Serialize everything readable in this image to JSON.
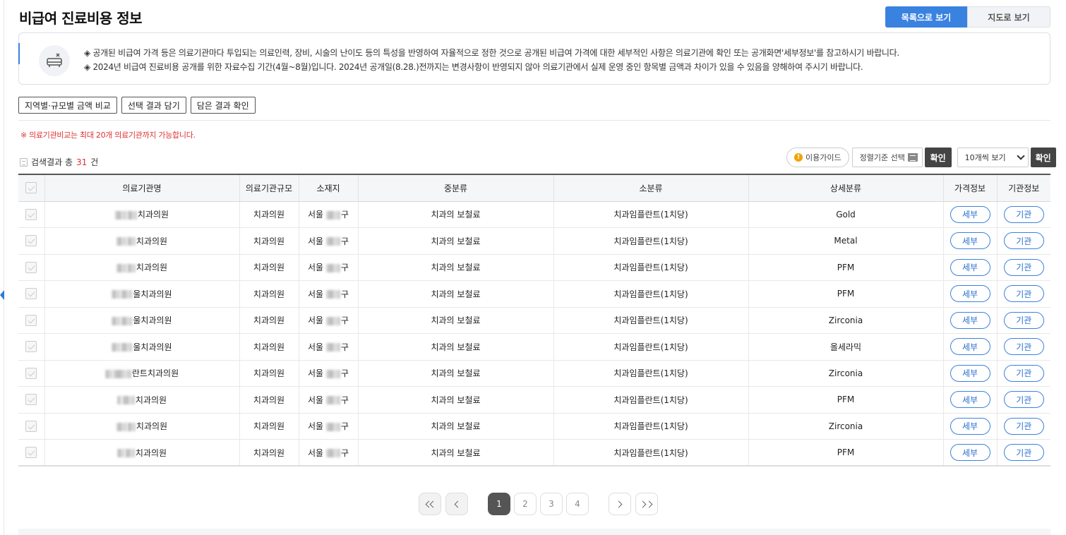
{
  "title": "비급여 진료비용 정보",
  "view_toggle": {
    "list": "목록으로 보기",
    "map": "지도로 보기"
  },
  "notice": {
    "icon": "hospital-bed-icon",
    "lines": [
      "◈ 공개된 비급여 가격 등은 의료기관마다 투입되는 의료인력, 장비, 시술의 난이도 등의 특성을 반영하여 자율적으로 정한 것으로 공개된 비급여 가격에 대한 세부적인 사항은 의료기관에 확인 또는 공개화면'세부정보'를 참고하시기 바랍니다.",
      "◈ 2024년 비급여 진료비용 공개를 위한 자료수집 기간(4월~8월)입니다. 2024년 공개일(8.28.)전까지는 변경사항이 반영되지 않아 의료기관에서 실제 운영 중인 항목별 금액과 차이가 있을 수 있음을 양해하여 주시기 바랍니다."
    ]
  },
  "actions": {
    "compare": "지역별·규모별 금액 비교",
    "add_selected": "선택 결과 담기",
    "view_saved": "담은 결과 확인"
  },
  "warning": "※ 의료기관비교는 최대 20개 의료기관까지 가능합니다.",
  "results": {
    "prefix": "검색결과 총",
    "count": "31",
    "suffix": "건"
  },
  "controls": {
    "guide": "이용가이드",
    "sort_placeholder": "정렬기준 선택",
    "confirm": "확인",
    "per_page": "10개씩 보기"
  },
  "table": {
    "headers": [
      "의료기관명",
      "의료기관규모",
      "소재지",
      "중분류",
      "소분류",
      "상세분류",
      "가격정보",
      "기관정보"
    ],
    "detail_label": "세부",
    "institution_label": "기관",
    "rows": [
      {
        "name": "치과의원",
        "size": "치과의원",
        "loc_prefix": "서울",
        "loc_suffix": "구",
        "mid": "치과의 보철료",
        "sub": "치과임플란트(1치당)",
        "detail": "Gold"
      },
      {
        "name": "치과의원",
        "size": "치과의원",
        "loc_prefix": "서울",
        "loc_suffix": "구",
        "mid": "치과의 보철료",
        "sub": "치과임플란트(1치당)",
        "detail": "Metal"
      },
      {
        "name": "치과의원",
        "size": "치과의원",
        "loc_prefix": "서울",
        "loc_suffix": "구",
        "mid": "치과의 보철료",
        "sub": "치과임플란트(1치당)",
        "detail": "PFM"
      },
      {
        "name": "울치과의원",
        "size": "치과의원",
        "loc_prefix": "서울",
        "loc_suffix": "구",
        "mid": "치과의 보철료",
        "sub": "치과임플란트(1치당)",
        "detail": "PFM"
      },
      {
        "name": "울치과의원",
        "size": "치과의원",
        "loc_prefix": "서울",
        "loc_suffix": "구",
        "mid": "치과의 보철료",
        "sub": "치과임플란트(1치당)",
        "detail": "Zirconia"
      },
      {
        "name": "울치과의원",
        "size": "치과의원",
        "loc_prefix": "서울",
        "loc_suffix": "구",
        "mid": "치과의 보철료",
        "sub": "치과임플란트(1치당)",
        "detail": "올세라믹"
      },
      {
        "name": "란트치과의원",
        "size": "치과의원",
        "loc_prefix": "서울",
        "loc_suffix": "구",
        "mid": "치과의 보철료",
        "sub": "치과임플란트(1치당)",
        "detail": "Zirconia"
      },
      {
        "name": "치과의원",
        "size": "치과의원",
        "loc_prefix": "서울",
        "loc_suffix": "구",
        "mid": "치과의 보철료",
        "sub": "치과임플란트(1치당)",
        "detail": "PFM"
      },
      {
        "name": "치과의원",
        "size": "치과의원",
        "loc_prefix": "서울",
        "loc_suffix": "구",
        "mid": "치과의 보철료",
        "sub": "치과임플란트(1치당)",
        "detail": "Zirconia"
      },
      {
        "name": "치과의원",
        "size": "치과의원",
        "loc_prefix": "서울",
        "loc_suffix": "구",
        "mid": "치과의 보철료",
        "sub": "치과임플란트(1치당)",
        "detail": "PFM"
      }
    ]
  },
  "pagination": {
    "pages": [
      "1",
      "2",
      "3",
      "4"
    ],
    "current": "1"
  }
}
